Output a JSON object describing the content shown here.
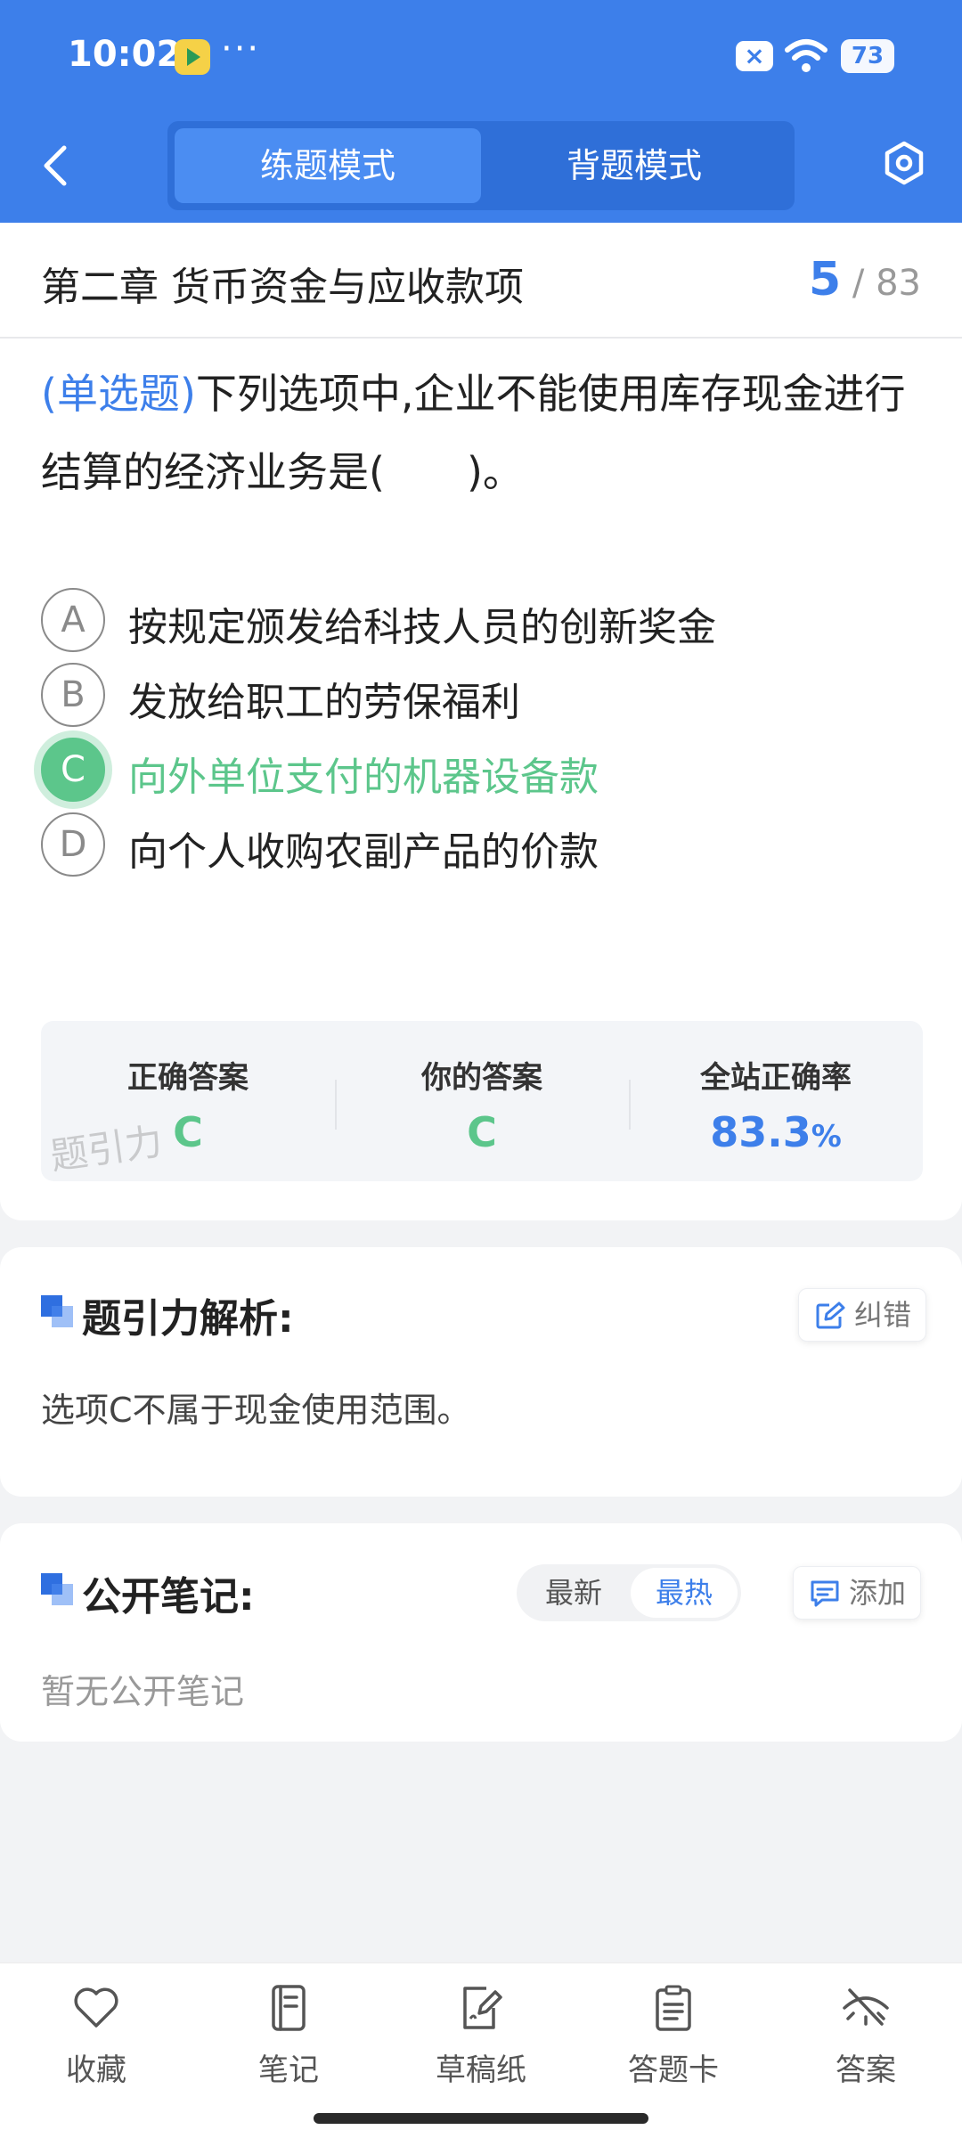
{
  "status_bar": {
    "time": "10:02",
    "dots": "···",
    "battery": "73",
    "notification_icon": "x-box-icon"
  },
  "header": {
    "tabs": [
      {
        "label": "练题模式",
        "active": true
      },
      {
        "label": "背题模式",
        "active": false
      }
    ],
    "back_icon": "chevron-left-icon",
    "settings_icon": "hexagon-settings-icon",
    "background_color": "#3d7fea"
  },
  "chapter": {
    "title": "第二章 货币资金与应收款项",
    "current": "5",
    "separator": "/",
    "total": "83"
  },
  "question": {
    "type_label": "(单选题)",
    "text": "下列选项中,企业不能使用库存现金进行结算的经济业务是(　　)。",
    "options": [
      {
        "letter": "A",
        "text": "按规定颁发给科技人员的创新奖金",
        "state": "default"
      },
      {
        "letter": "B",
        "text": "发放给职工的劳保福利",
        "state": "default"
      },
      {
        "letter": "C",
        "text": "向外单位支付的机器设备款",
        "state": "correct"
      },
      {
        "letter": "D",
        "text": "向个人收购农副产品的价款",
        "state": "default"
      }
    ]
  },
  "answer_summary": {
    "correct_label": "正确答案",
    "correct_value": "C",
    "yours_label": "你的答案",
    "yours_value": "C",
    "rate_label": "全站正确率",
    "rate_value": "83.3",
    "rate_unit": "%",
    "watermark": "题引力"
  },
  "analysis": {
    "title": "题引力解析:",
    "report_button": "纠错",
    "text": "选项C不属于现金使用范围。"
  },
  "notes": {
    "title": "公开笔记:",
    "sort_latest": "最新",
    "sort_hot": "最热",
    "add_button": "添加",
    "empty_text": "暂无公开笔记"
  },
  "bottom_tabs": [
    {
      "label": "收藏",
      "icon": "heart-icon"
    },
    {
      "label": "笔记",
      "icon": "notebook-icon"
    },
    {
      "label": "草稿纸",
      "icon": "draft-paper-icon"
    },
    {
      "label": "答题卡",
      "icon": "answer-card-icon"
    },
    {
      "label": "答案",
      "icon": "eye-off-icon"
    }
  ],
  "colors": {
    "accent": "#3d7fea",
    "correct": "#5cc68b"
  }
}
